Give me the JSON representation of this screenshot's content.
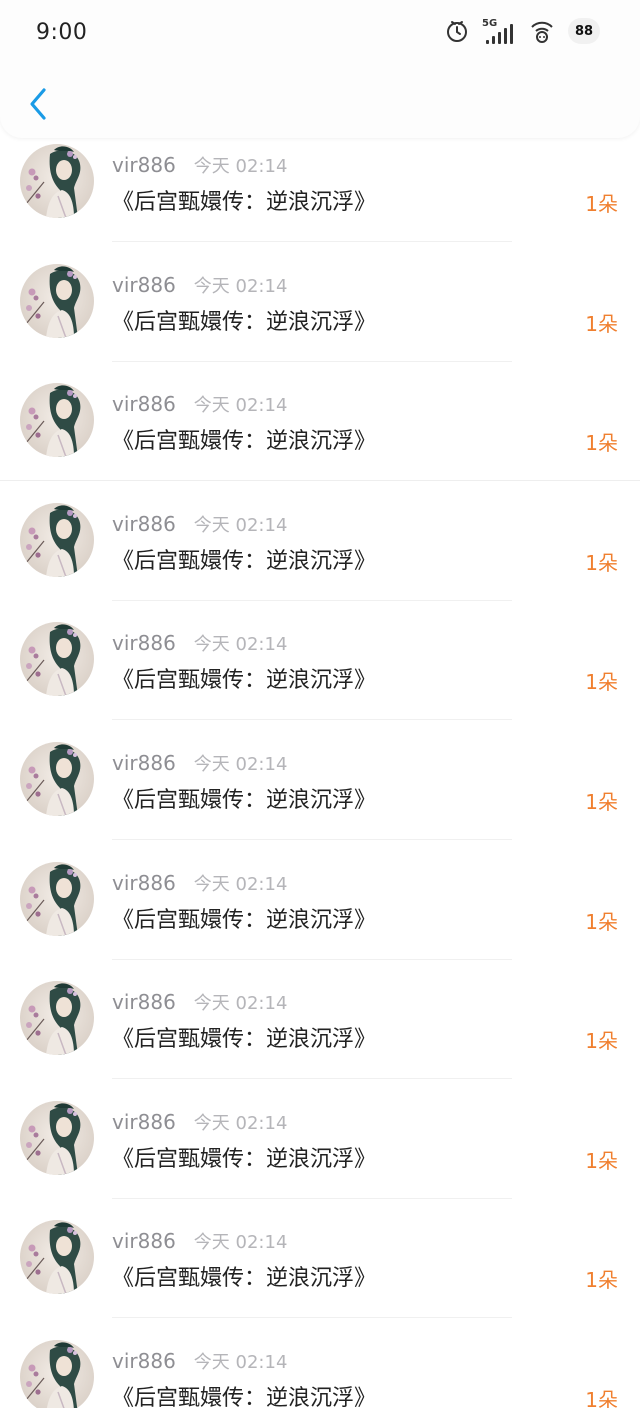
{
  "status_bar": {
    "time": "9:00",
    "network_label": "5G",
    "battery": "88"
  },
  "nav": {
    "back_icon": "chevron-left-icon",
    "accent_color": "#1a9be6"
  },
  "colors": {
    "amount": "#f07f2f",
    "username": "#8e8e93",
    "time": "#b5b5b9",
    "title": "#222222"
  },
  "records": [
    {
      "username": "vir886",
      "time": "今天 02:14",
      "title": "《后宫甄嬛传：逆浪沉浮》",
      "amount": "1朵"
    },
    {
      "username": "vir886",
      "time": "今天 02:14",
      "title": "《后宫甄嬛传：逆浪沉浮》",
      "amount": "1朵"
    },
    {
      "username": "vir886",
      "time": "今天 02:14",
      "title": "《后宫甄嬛传：逆浪沉浮》",
      "amount": "1朵"
    },
    {
      "username": "vir886",
      "time": "今天 02:14",
      "title": "《后宫甄嬛传：逆浪沉浮》",
      "amount": "1朵"
    },
    {
      "username": "vir886",
      "time": "今天 02:14",
      "title": "《后宫甄嬛传：逆浪沉浮》",
      "amount": "1朵"
    },
    {
      "username": "vir886",
      "time": "今天 02:14",
      "title": "《后宫甄嬛传：逆浪沉浮》",
      "amount": "1朵"
    },
    {
      "username": "vir886",
      "time": "今天 02:14",
      "title": "《后宫甄嬛传：逆浪沉浮》",
      "amount": "1朵"
    },
    {
      "username": "vir886",
      "time": "今天 02:14",
      "title": "《后宫甄嬛传：逆浪沉浮》",
      "amount": "1朵"
    },
    {
      "username": "vir886",
      "time": "今天 02:14",
      "title": "《后宫甄嬛传：逆浪沉浮》",
      "amount": "1朵"
    },
    {
      "username": "vir886",
      "time": "今天 02:14",
      "title": "《后宫甄嬛传：逆浪沉浮》",
      "amount": "1朵"
    },
    {
      "username": "vir886",
      "time": "今天 02:14",
      "title": "《后宫甄嬛传：逆浪沉浮》",
      "amount": "1朵"
    }
  ]
}
